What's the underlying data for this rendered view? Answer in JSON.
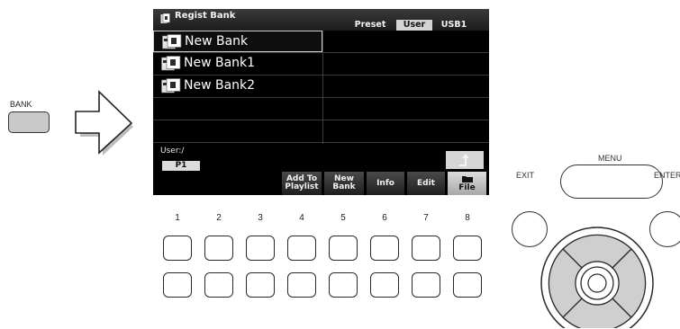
{
  "panel": {
    "bank_label": "BANK",
    "soft_buttons": [
      "1",
      "2",
      "3",
      "4",
      "5",
      "6",
      "7",
      "8"
    ],
    "exit_label": "EXIT",
    "menu_label": "MENU",
    "enter_label": "ENTER"
  },
  "screen": {
    "title": "Regist Bank",
    "title_icon": "registration-bank-icon",
    "tabs": [
      {
        "label": "Preset",
        "active": false
      },
      {
        "label": "User",
        "active": true
      },
      {
        "label": "USB1",
        "active": false
      }
    ],
    "files": [
      {
        "name": "New Bank",
        "selected": true,
        "icon": "bank-file-icon"
      },
      {
        "name": "New Bank1",
        "selected": false,
        "icon": "bank-file-icon"
      },
      {
        "name": "New Bank2",
        "selected": false,
        "icon": "bank-file-icon"
      }
    ],
    "path": "User:/",
    "page": "P1",
    "up_icon": "up-arrow-icon",
    "function_buttons": [
      {
        "label": "Add To\nPlaylist"
      },
      {
        "label": "New\nBank"
      },
      {
        "label": "Info"
      },
      {
        "label": "Edit"
      },
      {
        "label": "File",
        "icon": "folder-icon"
      }
    ]
  },
  "colors": {
    "screen_bg": "#000000",
    "active_tab": "#d4d4d4",
    "bank_button": "#c9c9c9",
    "dial_pad": "#cfcfcf"
  }
}
